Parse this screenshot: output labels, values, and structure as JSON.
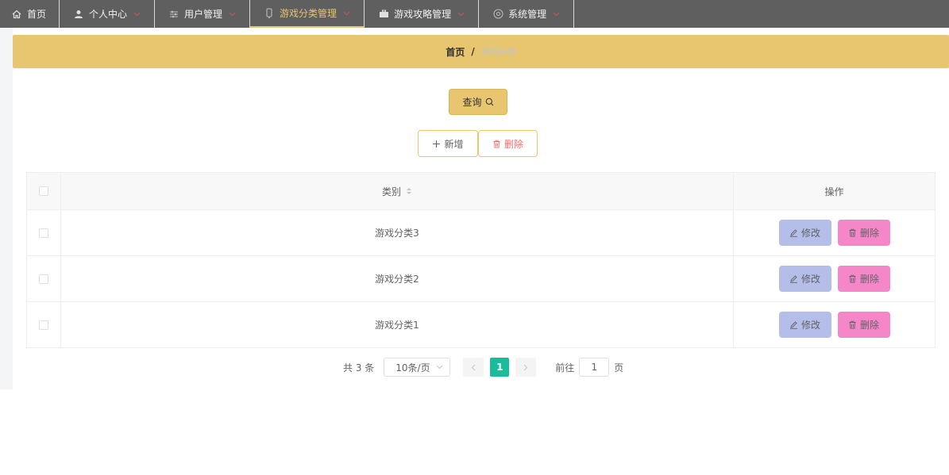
{
  "nav": {
    "items": [
      {
        "label": "首页",
        "icon": "home-icon"
      },
      {
        "label": "个人中心",
        "icon": "user-icon"
      },
      {
        "label": "用户管理",
        "icon": "sliders-icon"
      },
      {
        "label": "游戏分类管理",
        "icon": "device-icon",
        "active": true
      },
      {
        "label": "游戏攻略管理",
        "icon": "briefcase-icon"
      },
      {
        "label": "系统管理",
        "icon": "target-icon"
      }
    ],
    "active_color": "#e8c56c"
  },
  "breadcrumb": {
    "home": "首页",
    "separator": "/",
    "current": "游戏分类"
  },
  "toolbar": {
    "query_label": "查询",
    "add_label": "新增",
    "delete_label": "删除"
  },
  "table": {
    "columns": [
      "类别",
      "操作"
    ],
    "rows": [
      {
        "category": "游戏分类3",
        "edit_label": "修改",
        "delete_label": "删除"
      },
      {
        "category": "游戏分类2",
        "edit_label": "修改",
        "delete_label": "删除"
      },
      {
        "category": "游戏分类1",
        "edit_label": "修改",
        "delete_label": "删除"
      }
    ]
  },
  "pagination": {
    "total_text": "共 3 条",
    "page_size": "10条/页",
    "current_page": "1",
    "goto_prefix": "前往",
    "goto_value": "1",
    "goto_suffix": "页"
  },
  "colors": {
    "primary": "#e8c66f",
    "edit_button": "#b4bee8",
    "delete_button": "#f587c8",
    "page_active": "#1abc9c",
    "danger_text": "#f56c6c"
  }
}
